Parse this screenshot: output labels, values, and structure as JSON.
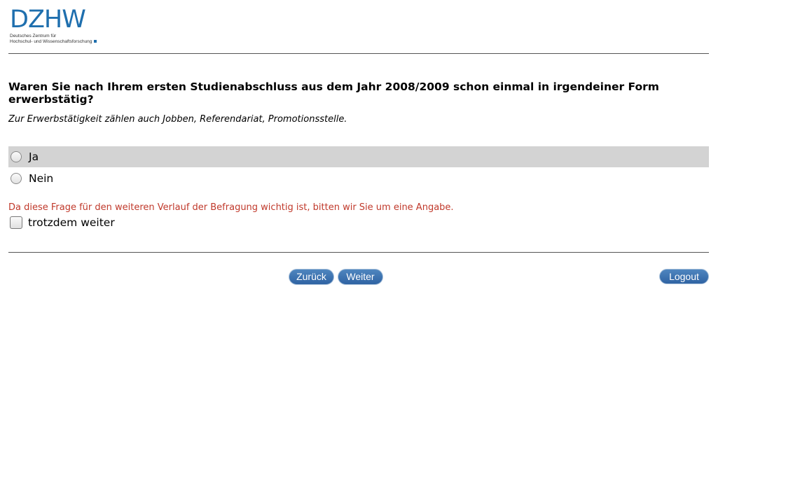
{
  "logo": {
    "wordmark": "DZHW",
    "subtitle_line1": "Deutsches Zentrum für",
    "subtitle_line2": "Hochschul- und Wissenschaftsforschung"
  },
  "question": {
    "title": "Waren Sie nach Ihrem ersten Studienabschluss aus dem Jahr 2008/2009 schon einmal in irgendeiner Form erwerbstätig?",
    "hint": "Zur Erwerbstätigkeit zählen auch Jobben, Referendariat, Promotionsstelle."
  },
  "options": [
    {
      "label": "Ja",
      "highlighted": true,
      "selected": false
    },
    {
      "label": "Nein",
      "highlighted": false,
      "selected": false
    }
  ],
  "warning": {
    "text": "Da diese Frage für den weiteren Verlauf der Befragung wichtig ist, bitten wir Sie um eine Angabe.",
    "color": "#c0392b"
  },
  "skip": {
    "label": "trotzdem weiter",
    "checked": false
  },
  "navigation": {
    "back_label": "Zurück",
    "next_label": "Weiter",
    "logout_label": "Logout"
  },
  "colors": {
    "brand": "#1f6fae",
    "highlight_row": "#d3d3d3",
    "button": "#3a6eaa"
  }
}
